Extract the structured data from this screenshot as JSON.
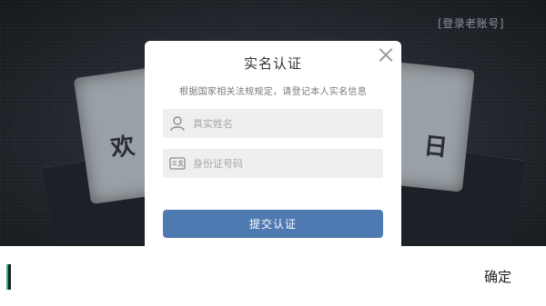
{
  "background": {
    "left_paper_glyph": "欢",
    "right_paper_glyph": "日"
  },
  "header": {
    "switch_account_label": "[登录老账号]"
  },
  "modal": {
    "title": "实名认证",
    "description": "根据国家相关法规规定，请登记本人实名信息",
    "name_field": {
      "placeholder": "真实姓名",
      "value": "",
      "icon": "person-icon"
    },
    "id_field": {
      "placeholder": "身份证号码",
      "value": "",
      "icon": "id-card-icon"
    },
    "submit_label": "提交认证",
    "close_icon": "close-icon"
  },
  "bottom_bar": {
    "input_value": "",
    "confirm_label": "确定"
  },
  "colors": {
    "accent": "#4e7ab1",
    "cursor_accent": "#2fb38e"
  }
}
